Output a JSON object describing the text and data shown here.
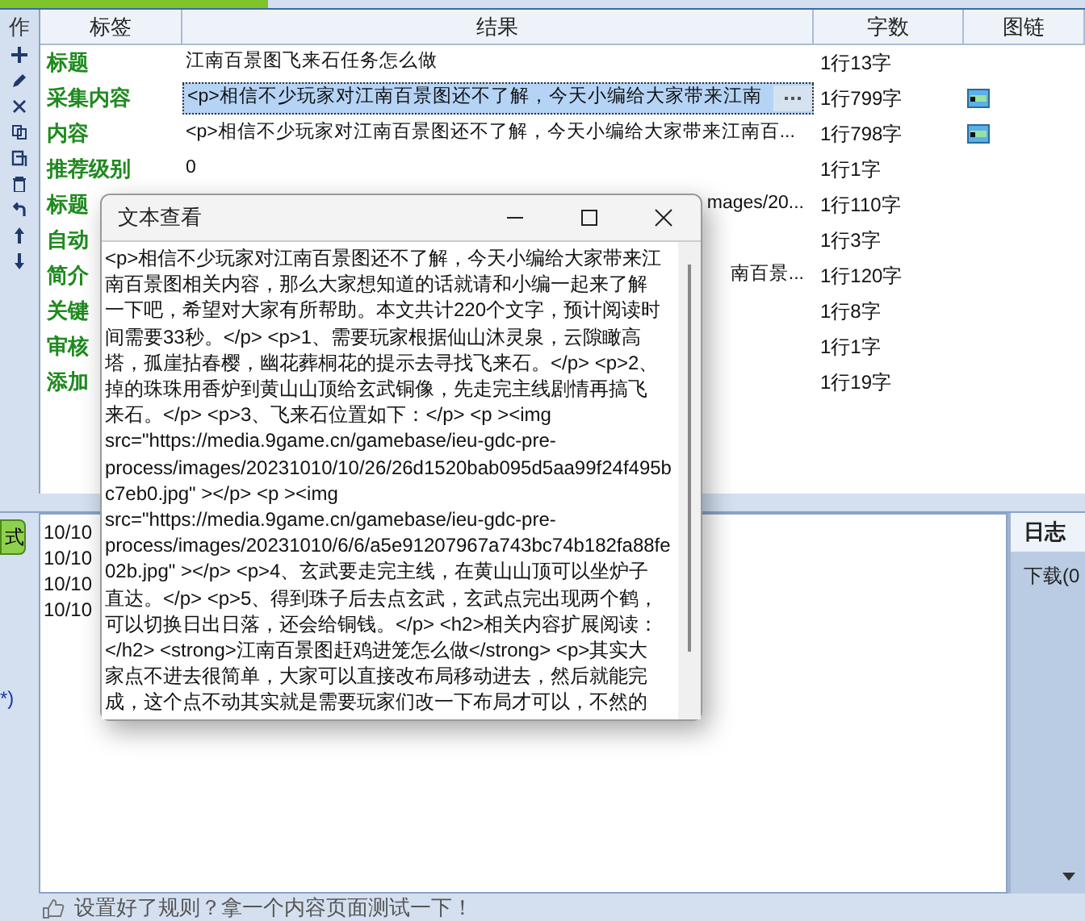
{
  "side_label": "作",
  "table": {
    "columns": [
      "标签",
      "结果",
      "字数",
      "图链"
    ],
    "rows": [
      {
        "label": "标题",
        "result": "江南百景图飞来石任务怎么做",
        "count": "1行13字",
        "image_link": false,
        "selected": false,
        "clipped": false
      },
      {
        "label": "采集内容",
        "result": "<p>相信不少玩家对江南百景图还不了解，今天小编给大家带来江南",
        "count": "1行799字",
        "image_link": true,
        "selected": true,
        "clipped": false
      },
      {
        "label": "内容",
        "result": "<p>相信不少玩家对江南百景图还不了解，今天小编给大家带来江南百...",
        "count": "1行798字",
        "image_link": true,
        "selected": false,
        "clipped": false
      },
      {
        "label": "推荐级别",
        "result": "0",
        "count": "1行1字",
        "image_link": false,
        "selected": false,
        "clipped": false
      },
      {
        "label": "标题",
        "result": "mages/20...",
        "count": "1行110字",
        "image_link": false,
        "selected": false,
        "clipped": true
      },
      {
        "label": "自动",
        "count": "1行3字",
        "image_link": false,
        "selected": false
      },
      {
        "label": "简介",
        "result": "南百景...",
        "count": "1行120字",
        "image_link": false,
        "selected": false,
        "clipped": true
      },
      {
        "label": "关键",
        "count": "1行8字",
        "image_link": false,
        "selected": false
      },
      {
        "label": "审核",
        "count": "1行1字",
        "image_link": false,
        "selected": false
      },
      {
        "label": "添加",
        "count": "1行19字",
        "image_link": false,
        "selected": false
      }
    ]
  },
  "left_panel": {
    "button": "式",
    "note": "*)"
  },
  "log": {
    "lines": [
      "10/10",
      "10/10",
      "10/10",
      "10/10"
    ]
  },
  "side_panel": {
    "tab": "日志",
    "item": "下载(0"
  },
  "status_bar": "设置好了规则？拿一个内容页面测试一下！",
  "dialog": {
    "title": "文本查看",
    "lines": [
      "<p>相信不少玩家对江南百景图还不了解，今天小编给大家带来江",
      "南百景图相关内容，那么大家想知道的话就请和小编一起来了解",
      "一下吧，希望对大家有所帮助。本文共计220个文字，预计阅读时",
      "间需要33秒。</p> <p>1、需要玩家根据仙山沐灵泉，云隙瞰高",
      "塔，孤崖拈春樱，幽花葬桐花的提示去寻找飞来石。</p> <p>2、",
      "掉的珠珠用香炉到黄山山顶给玄武铜像，先走完主线剧情再搞飞",
      "来石。</p> <p>3、飞来石位置如下：</p> <p ><img",
      "src=\"https://media.9game.cn/gamebase/ieu-gdc-pre-",
      "process/images/20231010/10/26/26d1520bab095d5aa99f24f495b",
      "c7eb0.jpg\" ></p> <p ><img",
      "src=\"https://media.9game.cn/gamebase/ieu-gdc-pre-",
      "process/images/20231010/6/6/a5e91207967a743bc74b182fa88fe",
      "02b.jpg\" ></p> <p>4、玄武要走完主线，在黄山山顶可以坐炉子",
      "直达。</p> <p>5、得到珠子后去点玄武，玄武点完出现两个鹤，",
      "可以切换日出日落，还会给铜钱。</p> <h2>相关内容扩展阅读：",
      "</h2> <strong>江南百景图赶鸡进笼怎么做</strong> <p>其实大",
      "家点不进去很简单，大家可以直接改布局移动进去，然后就能完",
      "成，这个点不动其实就是需要玩家们改一下布局才可以，不然的"
    ]
  }
}
